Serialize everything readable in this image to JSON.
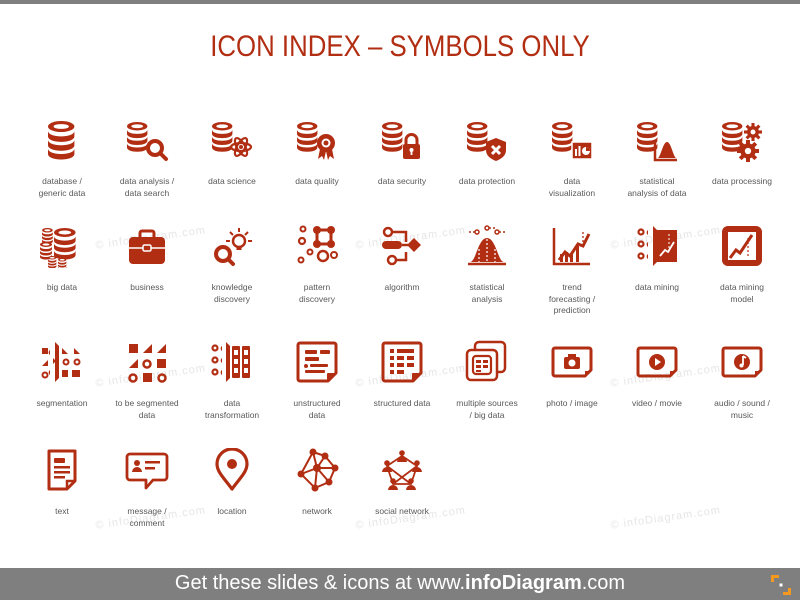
{
  "title": "ICON INDEX – SYMBOLS ONLY",
  "accent_color": "#b22e13",
  "rows": [
    [
      {
        "icon": "database-icon",
        "label": "database /\ngeneric data"
      },
      {
        "icon": "data-search-icon",
        "label": "data analysis /\ndata search"
      },
      {
        "icon": "data-science-icon",
        "label": "data science"
      },
      {
        "icon": "data-quality-icon",
        "label": "data quality"
      },
      {
        "icon": "data-security-icon",
        "label": "data security"
      },
      {
        "icon": "data-protection-icon",
        "label": "data protection"
      },
      {
        "icon": "data-visualization-icon",
        "label": "data\nvisualization"
      },
      {
        "icon": "statistical-analysis-data-icon",
        "label": "statistical\nanalysis of data"
      },
      {
        "icon": "data-processing-icon",
        "label": "data processing"
      }
    ],
    [
      {
        "icon": "big-data-icon",
        "label": "big  data"
      },
      {
        "icon": "briefcase-icon",
        "label": "business"
      },
      {
        "icon": "knowledge-discovery-icon",
        "label": "knowledge\ndiscovery"
      },
      {
        "icon": "pattern-discovery-icon",
        "label": "pattern\ndiscovery"
      },
      {
        "icon": "algorithm-icon",
        "label": "algorithm"
      },
      {
        "icon": "bell-curve-icon",
        "label": "statistical\nanalysis"
      },
      {
        "icon": "trend-chart-icon",
        "label": "trend\nforecasting  /\nprediction"
      },
      {
        "icon": "data-mining-icon",
        "label": "data mining"
      },
      {
        "icon": "data-mining-model-icon",
        "label": "data mining\nmodel"
      }
    ],
    [
      {
        "icon": "segmentation-icon",
        "label": "segmentation"
      },
      {
        "icon": "unsegmented-data-icon",
        "label": "to be segmented\ndata"
      },
      {
        "icon": "data-transformation-icon",
        "label": "data\ntransformation"
      },
      {
        "icon": "unstructured-data-icon",
        "label": "unstructured\ndata"
      },
      {
        "icon": "structured-data-icon",
        "label": "structured  data"
      },
      {
        "icon": "multiple-sources-icon",
        "label": "multiple  sources\n/ big data"
      },
      {
        "icon": "photo-icon",
        "label": "photo  / image"
      },
      {
        "icon": "video-icon",
        "label": "video / movie"
      },
      {
        "icon": "audio-icon",
        "label": "audio / sound /\nmusic"
      }
    ],
    [
      {
        "icon": "text-document-icon",
        "label": "text"
      },
      {
        "icon": "message-icon",
        "label": "message /\ncomment"
      },
      {
        "icon": "location-pin-icon",
        "label": "location"
      },
      {
        "icon": "network-icon",
        "label": "network"
      },
      {
        "icon": "social-network-icon",
        "label": "social network"
      }
    ]
  ],
  "watermark": "© infoDiagram.com",
  "footer": {
    "prefix": "Get these slides & icons at www.",
    "brand": "infoDiagram",
    "suffix": ".com"
  }
}
